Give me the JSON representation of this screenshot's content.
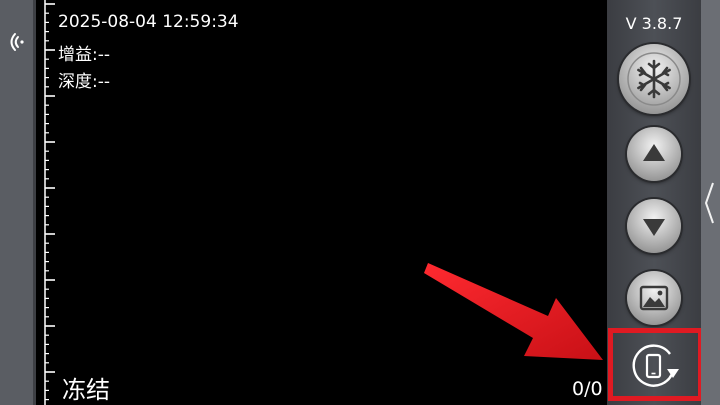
{
  "app": {
    "version": "V 3.8.7"
  },
  "overlay": {
    "timestamp": "2025-08-04 12:59:34",
    "gain_label": "增益:",
    "gain_value": "--",
    "depth_label": "深度:",
    "depth_value": "--",
    "freeze_label": "冻结",
    "frame_counter": "0/0"
  },
  "controls": {
    "freeze_icon": "snowflake-icon",
    "up_icon": "triangle-up-icon",
    "down_icon": "triangle-down-icon",
    "gallery_icon": "image-icon",
    "rotate_icon": "rotate-screen-icon",
    "wifi_icon": "wifi-icon"
  },
  "colors": {
    "highlight": "#e01a22",
    "panel": "#4d5056",
    "rail": "#5a5d63"
  }
}
